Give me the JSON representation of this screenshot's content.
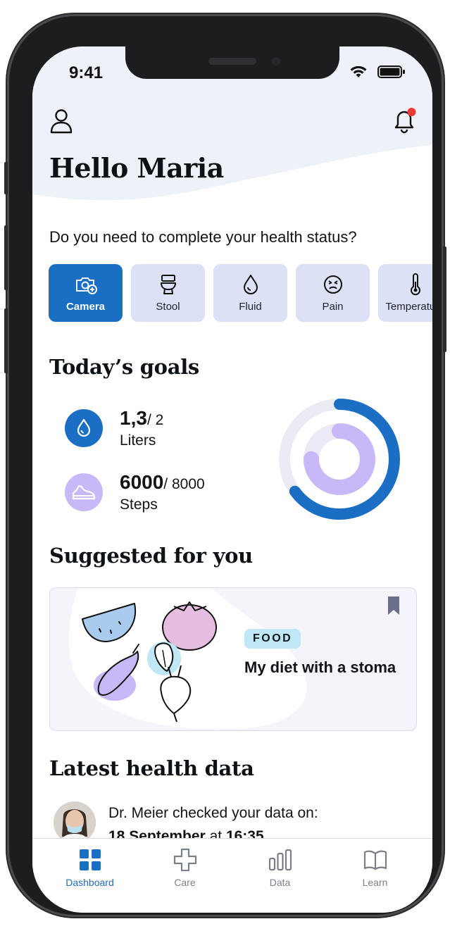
{
  "status_bar": {
    "time": "9:41"
  },
  "header": {
    "greeting": "Hello Maria"
  },
  "health_status": {
    "question": "Do you need to complete your health status?",
    "chips": [
      {
        "label": "Camera",
        "icon": "camera-icon",
        "active": true
      },
      {
        "label": "Stool",
        "icon": "toilet-icon",
        "active": false
      },
      {
        "label": "Fluid",
        "icon": "drop-icon",
        "active": false
      },
      {
        "label": "Pain",
        "icon": "pain-face-icon",
        "active": false
      },
      {
        "label": "Temperature",
        "icon": "thermometer-icon",
        "active": false
      }
    ]
  },
  "goals": {
    "title": "Today’s goals",
    "items": [
      {
        "value": "1,3",
        "target": "/ 2",
        "unit": "Liters",
        "icon": "water-drop-icon",
        "progress": 0.65,
        "color": "#1a6fc4"
      },
      {
        "value": "6000",
        "target": "/ 8000",
        "unit": "Steps",
        "icon": "sneaker-icon",
        "progress": 0.75,
        "color": "#c9b8f7"
      }
    ]
  },
  "suggested": {
    "title": "Suggested for you",
    "card": {
      "badge": "FOOD",
      "title": "My diet with a stoma"
    }
  },
  "health_data": {
    "title": "Latest health data",
    "checked_text": "Dr. Meier checked your data on:",
    "date": "18 September",
    "at_text": "at",
    "time": "16:35"
  },
  "tabs": [
    {
      "label": "Dashboard",
      "icon": "grid-icon",
      "active": true
    },
    {
      "label": "Care",
      "icon": "plus-cross-icon",
      "active": false
    },
    {
      "label": "Data",
      "icon": "bars-icon",
      "active": false
    },
    {
      "label": "Learn",
      "icon": "book-icon",
      "active": false
    }
  ],
  "colors": {
    "primary": "#1a6fc4",
    "chip_bg": "#dde1f6",
    "lavender": "#c9b8f7",
    "notification": "#ef3b36"
  }
}
